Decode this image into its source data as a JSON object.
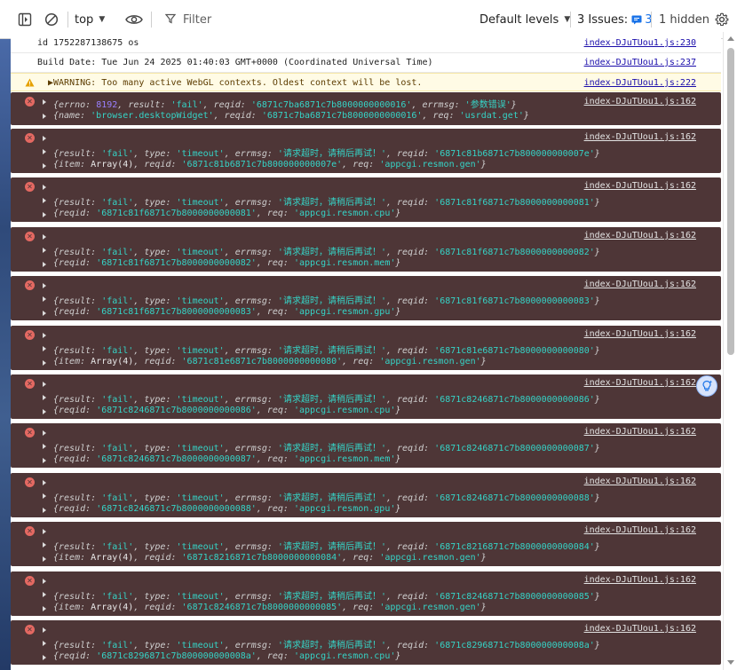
{
  "toolbar": {
    "context_label": "top",
    "filter_placeholder": "Filter",
    "levels_label": "Default levels",
    "issues_label": "3 Issues:",
    "issues_count": "3",
    "hidden_label": "1 hidden"
  },
  "logs": {
    "plain": [
      {
        "text": "id 1752287138675 os",
        "source": "index-DJuTUou1.js:230"
      },
      {
        "text": "Build Date: Tue Jun 24 2025 01:40:03 GMT+0000 (Coordinated Universal Time)",
        "source": "index-DJuTUou1.js:237"
      }
    ],
    "warning": {
      "text": "▶WARNING: Too many active WebGL contexts. Oldest context will be lost.",
      "source": "index-DJuTUou1.js:222"
    },
    "first_error": {
      "source": "index-DJuTUou1.js:162",
      "line1": {
        "errno_key": "{errno:",
        "errno_val": "8192",
        "result_key": ", result:",
        "result_val": "'fail'",
        "reqid_key": ", reqid:",
        "reqid_val": "'6871c7ba6871c7b8000000000016'",
        "errmsg_key": ", errmsg:",
        "errmsg_val": "'参数错误'",
        "end": "}"
      },
      "line2": {
        "name_key": "{name:",
        "name_val": "'browser.desktopWidget'",
        "reqid_key": ", reqid:",
        "reqid_val": "'6871c7ba6871c7b8000000000016'",
        "req_key": ", req:",
        "req_val": "'usrdat.get'",
        "end": "}"
      }
    },
    "errors": [
      {
        "source": "index-DJuTUou1.js:162",
        "reqid": "'6871c81b6871c7b800000000007e'",
        "second": {
          "prefix": "{item:",
          "array": "Array(4)",
          "reqid": "'6871c81b6871c7b800000000007e'",
          "req": "'appcgi.resmon.gen'"
        }
      },
      {
        "source": "index-DJuTUou1.js:162",
        "reqid": "'6871c81f6871c7b8000000000081'",
        "second": {
          "prefix": "{reqid:",
          "array": "",
          "reqid": "'6871c81f6871c7b8000000000081'",
          "req": "'appcgi.resmon.cpu'"
        }
      },
      {
        "source": "index-DJuTUou1.js:162",
        "reqid": "'6871c81f6871c7b8000000000082'",
        "second": {
          "prefix": "{reqid:",
          "array": "",
          "reqid": "'6871c81f6871c7b8000000000082'",
          "req": "'appcgi.resmon.mem'"
        }
      },
      {
        "source": "index-DJuTUou1.js:162",
        "reqid": "'6871c81f6871c7b8000000000083'",
        "second": {
          "prefix": "{reqid:",
          "array": "",
          "reqid": "'6871c81f6871c7b8000000000083'",
          "req": "'appcgi.resmon.gpu'"
        }
      },
      {
        "source": "index-DJuTUou1.js:162",
        "reqid": "'6871c81e6871c7b8000000000080'",
        "second": {
          "prefix": "{item:",
          "array": "Array(4)",
          "reqid": "'6871c81e6871c7b8000000000080'",
          "req": "'appcgi.resmon.gen'"
        }
      },
      {
        "source": "index-DJuTUou1.js:162",
        "reqid": "'6871c8246871c7b8000000000086'",
        "second": {
          "prefix": "{reqid:",
          "array": "",
          "reqid": "'6871c8246871c7b8000000000086'",
          "req": "'appcgi.resmon.cpu'"
        }
      },
      {
        "source": "index-DJuTUou1.js:162",
        "reqid": "'6871c8246871c7b8000000000087'",
        "second": {
          "prefix": "{reqid:",
          "array": "",
          "reqid": "'6871c8246871c7b8000000000087'",
          "req": "'appcgi.resmon.mem'"
        }
      },
      {
        "source": "index-DJuTUou1.js:162",
        "reqid": "'6871c8246871c7b8000000000088'",
        "second": {
          "prefix": "{reqid:",
          "array": "",
          "reqid": "'6871c8246871c7b8000000000088'",
          "req": "'appcgi.resmon.gpu'"
        }
      },
      {
        "source": "index-DJuTUou1.js:162",
        "reqid": "'6871c8216871c7b8000000000084'",
        "second": {
          "prefix": "{item:",
          "array": "Array(4)",
          "reqid": "'6871c8216871c7b8000000000084'",
          "req": "'appcgi.resmon.gen'"
        }
      },
      {
        "source": "index-DJuTUou1.js:162",
        "reqid": "'6871c8246871c7b8000000000085'",
        "second": {
          "prefix": "{item:",
          "array": "Array(4)",
          "reqid": "'6871c8246871c7b8000000000085'",
          "req": "'appcgi.resmon.gen'"
        }
      },
      {
        "source": "index-DJuTUou1.js:162",
        "reqid": "'6871c8296871c7b800000000008a'",
        "second": {
          "prefix": "{reqid:",
          "array": "",
          "reqid": "'6871c8296871c7b800000000008a'",
          "req": "'appcgi.resmon.cpu'"
        }
      }
    ],
    "error_line1": {
      "result_key": "{result:",
      "result_val": "'fail'",
      "type_key": ", type:",
      "type_val": "'timeout'",
      "errmsg_key": ", errmsg:",
      "errmsg_val": "'请求超时，请稍后再试！'",
      "reqid_key": ", reqid:",
      "end": "}"
    },
    "error_line2": {
      "reqid_key": ", reqid:",
      "req_key": ", req:",
      "end": "}"
    }
  },
  "colors": {
    "error_bg": "#4e3637",
    "error_icon": "#e46962",
    "string": "#35d4c7",
    "number": "#9980ff",
    "link": "#1a0dab"
  }
}
